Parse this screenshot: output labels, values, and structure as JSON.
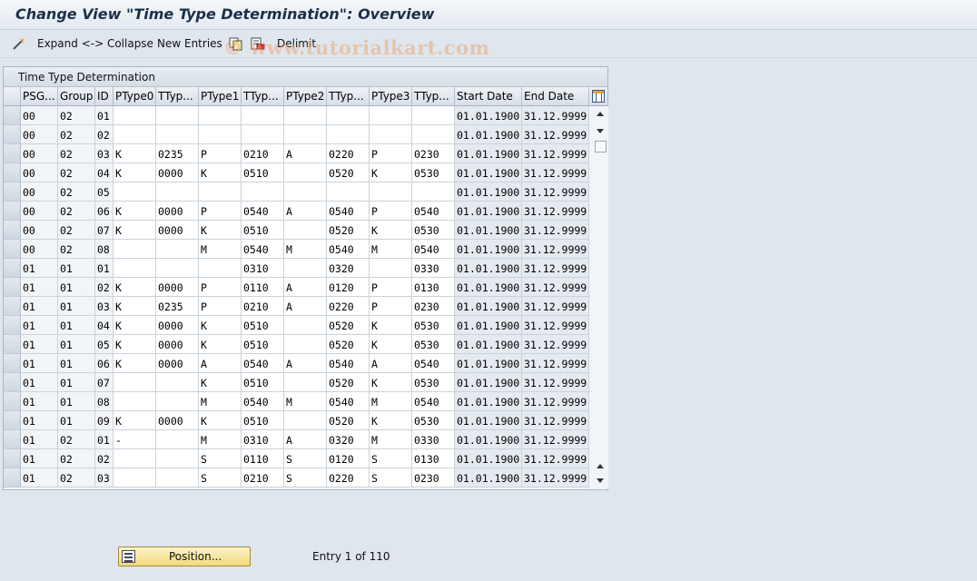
{
  "title": "Change View \"Time Type Determination\": Overview",
  "toolbar": {
    "expand_collapse": "Expand <-> Collapse",
    "new_entries": "New Entries",
    "delimit": "Delimit"
  },
  "watermark": "© www.tutorialkart.com",
  "table": {
    "title": "Time Type Determination",
    "columns": [
      "PSG...",
      "Group",
      "ID",
      "PType0",
      "TTyp...",
      "PType1",
      "TTyp...",
      "PType2",
      "TTyp...",
      "PType3",
      "TTyp...",
      "Start Date",
      "End Date"
    ],
    "rows": [
      [
        "00",
        "02",
        "01",
        "",
        "",
        "",
        "",
        "",
        "",
        "",
        "",
        "01.01.1900",
        "31.12.9999"
      ],
      [
        "00",
        "02",
        "02",
        "",
        "",
        "",
        "",
        "",
        "",
        "",
        "",
        "01.01.1900",
        "31.12.9999"
      ],
      [
        "00",
        "02",
        "03",
        "K",
        "0235",
        "P",
        "0210",
        "A",
        "0220",
        "P",
        "0230",
        "01.01.1900",
        "31.12.9999"
      ],
      [
        "00",
        "02",
        "04",
        "K",
        "0000",
        "K",
        "0510",
        "",
        "0520",
        "K",
        "0530",
        "01.01.1900",
        "31.12.9999"
      ],
      [
        "00",
        "02",
        "05",
        "",
        "",
        "",
        "",
        "",
        "",
        "",
        "",
        "01.01.1900",
        "31.12.9999"
      ],
      [
        "00",
        "02",
        "06",
        "K",
        "0000",
        "P",
        "0540",
        "A",
        "0540",
        "P",
        "0540",
        "01.01.1900",
        "31.12.9999"
      ],
      [
        "00",
        "02",
        "07",
        "K",
        "0000",
        "K",
        "0510",
        "",
        "0520",
        "K",
        "0530",
        "01.01.1900",
        "31.12.9999"
      ],
      [
        "00",
        "02",
        "08",
        "",
        "",
        "M",
        "0540",
        "M",
        "0540",
        "M",
        "0540",
        "01.01.1900",
        "31.12.9999"
      ],
      [
        "01",
        "01",
        "01",
        "",
        "",
        "",
        "0310",
        "",
        "0320",
        "",
        "0330",
        "01.01.1900",
        "31.12.9999"
      ],
      [
        "01",
        "01",
        "02",
        "K",
        "0000",
        "P",
        "0110",
        "A",
        "0120",
        "P",
        "0130",
        "01.01.1900",
        "31.12.9999"
      ],
      [
        "01",
        "01",
        "03",
        "K",
        "0235",
        "P",
        "0210",
        "A",
        "0220",
        "P",
        "0230",
        "01.01.1900",
        "31.12.9999"
      ],
      [
        "01",
        "01",
        "04",
        "K",
        "0000",
        "K",
        "0510",
        "",
        "0520",
        "K",
        "0530",
        "01.01.1900",
        "31.12.9999"
      ],
      [
        "01",
        "01",
        "05",
        "K",
        "0000",
        "K",
        "0510",
        "",
        "0520",
        "K",
        "0530",
        "01.01.1900",
        "31.12.9999"
      ],
      [
        "01",
        "01",
        "06",
        "K",
        "0000",
        "A",
        "0540",
        "A",
        "0540",
        "A",
        "0540",
        "01.01.1900",
        "31.12.9999"
      ],
      [
        "01",
        "01",
        "07",
        "",
        "",
        "K",
        "0510",
        "",
        "0520",
        "K",
        "0530",
        "01.01.1900",
        "31.12.9999"
      ],
      [
        "01",
        "01",
        "08",
        "",
        "",
        "M",
        "0540",
        "M",
        "0540",
        "M",
        "0540",
        "01.01.1900",
        "31.12.9999"
      ],
      [
        "01",
        "01",
        "09",
        "K",
        "0000",
        "K",
        "0510",
        "",
        "0520",
        "K",
        "0530",
        "01.01.1900",
        "31.12.9999"
      ],
      [
        "01",
        "02",
        "01",
        "-",
        "",
        "M",
        "0310",
        "A",
        "0320",
        "M",
        "0330",
        "01.01.1900",
        "31.12.9999"
      ],
      [
        "01",
        "02",
        "02",
        "",
        "",
        "S",
        "0110",
        "S",
        "0120",
        "S",
        "0130",
        "01.01.1900",
        "31.12.9999"
      ],
      [
        "01",
        "02",
        "03",
        "",
        "",
        "S",
        "0210",
        "S",
        "0220",
        "S",
        "0230",
        "01.01.1900",
        "31.12.9999"
      ]
    ]
  },
  "footer": {
    "position_button": "Position...",
    "entry_info": "Entry 1 of 110"
  },
  "icons": {
    "expand": "magic-wand-icon",
    "copy": "copy-icon",
    "delete": "delete-icon",
    "table_settings": "table-settings-icon",
    "position": "position-icon"
  },
  "colors": {
    "background": "#dfe6ee",
    "title_text": "#1c2f47",
    "position_button": "#f1d97b"
  }
}
